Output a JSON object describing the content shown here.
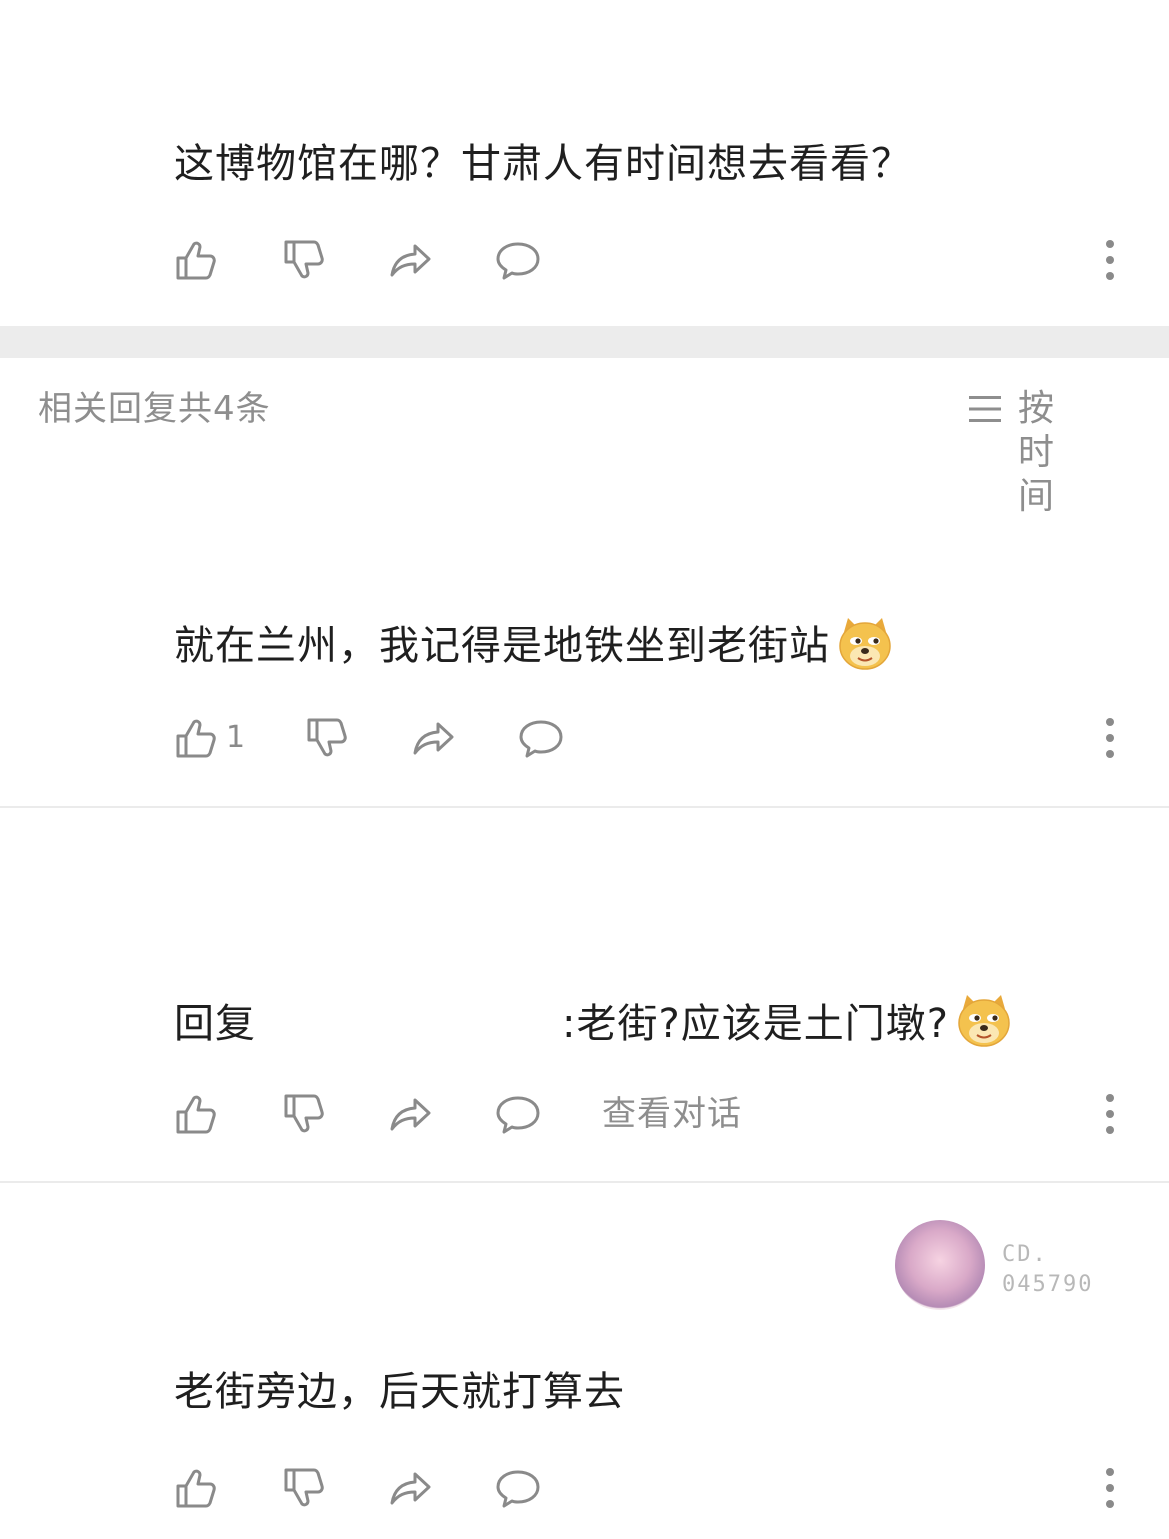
{
  "comment": {
    "text": "这博物馆在哪？甘肃人有时间想去看看？"
  },
  "replies_header": {
    "title": "相关回复共4条",
    "sort_label": "按时间"
  },
  "replies": [
    {
      "text": "就在兰州，我记得是地铁坐到老街站",
      "emoji": "doge-emoji",
      "like_count": "1"
    },
    {
      "reply_prefix": "回复",
      "text": ":老街?应该是土门墩?",
      "emoji": "doge-emoji",
      "view_conversation": "查看对话"
    },
    {
      "badge_line1": "CD.",
      "badge_line2": "045790",
      "text": "老街旁边，后天就打算去"
    }
  ],
  "icons": {
    "like": "thumbs-up-icon",
    "dislike": "thumbs-down-icon",
    "share": "share-icon",
    "comment": "comment-icon",
    "more": "more-vertical-icon"
  },
  "colors": {
    "icon_gray": "#8a8a8a",
    "text_main": "#1f1f1f",
    "text_muted": "#8e8e8e",
    "band": "#ececec",
    "doge_fill": "#f4c24e"
  }
}
